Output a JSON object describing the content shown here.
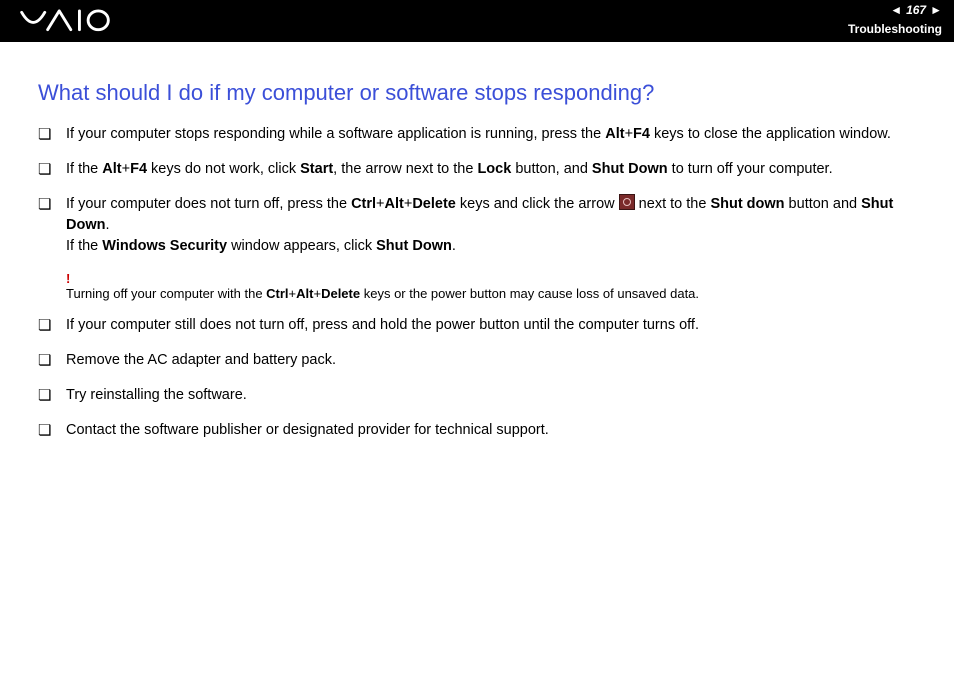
{
  "header": {
    "page_number": "167",
    "section": "Troubleshooting"
  },
  "title": "What should I do if my computer or software stops responding?",
  "bullets": {
    "b1a": "If your computer stops responding while a software application is running, press the ",
    "b1b": "Alt",
    "b1c": "+",
    "b1d": "F4",
    "b1e": " keys to close the application window.",
    "b2a": "If the ",
    "b2b": "Alt",
    "b2c": "+",
    "b2d": "F4",
    "b2e": " keys do not work, click ",
    "b2f": "Start",
    "b2g": ", the arrow next to the ",
    "b2h": "Lock",
    "b2i": " button, and ",
    "b2j": "Shut Down",
    "b2k": " to turn off your computer.",
    "b3a": "If your computer does not turn off, press the ",
    "b3b": "Ctrl",
    "b3c": "+",
    "b3d": "Alt",
    "b3e": "+",
    "b3f": "Delete",
    "b3g": " keys and click the arrow ",
    "b3h": " next to the ",
    "b3i": "Shut down",
    "b3j": " button and ",
    "b3k": "Shut Down",
    "b3l": ".",
    "b3m": "If the ",
    "b3n": "Windows Security",
    "b3o": " window appears, click ",
    "b3p": "Shut Down",
    "b3q": ".",
    "b4": "If your computer still does not turn off, press and hold the power button until the computer turns off.",
    "b5": "Remove the AC adapter and battery pack.",
    "b6": "Try reinstalling the software.",
    "b7": "Contact the software publisher or designated provider for technical support."
  },
  "warning": {
    "bang": "!",
    "wa": "Turning off your computer with the ",
    "wb": "Ctrl",
    "wc": "+",
    "wd": "Alt",
    "we": "+",
    "wf": "Delete",
    "wg": " keys or the power button may cause loss of unsaved data."
  }
}
